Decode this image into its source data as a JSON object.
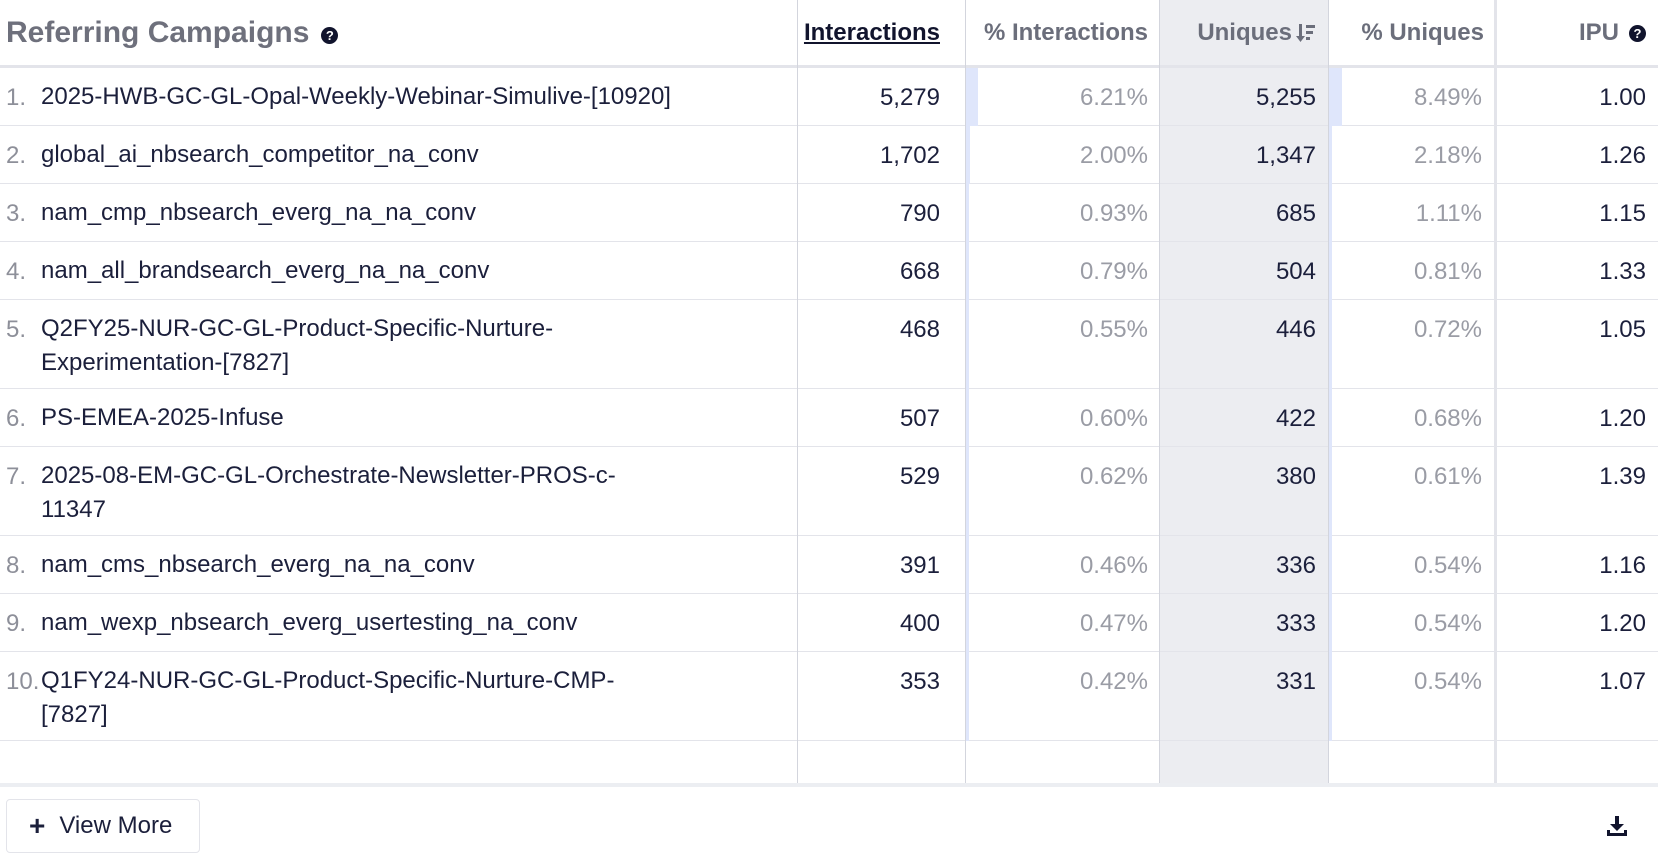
{
  "header": {
    "title": "Referring Campaigns",
    "help_icon": "question-circle-icon",
    "columns": [
      "Interactions",
      "% Interactions",
      "Uniques",
      "% Uniques",
      "IPU"
    ],
    "sort_icon": "sort-descending-icon"
  },
  "rows": [
    {
      "index": "1.",
      "name_lines": [
        "2025-HWB-GC-GL-Opal-Weekly-Webinar-Simulive-[10920]"
      ],
      "interactions": "5,279",
      "pct_interactions": "6.21%",
      "pct_interactions_value": 6.21,
      "uniques": "5,255",
      "pct_uniques": "8.49%",
      "pct_uniques_value": 8.49,
      "ipu": "1.00"
    },
    {
      "index": "2.",
      "name_lines": [
        "global_ai_nbsearch_competitor_na_conv"
      ],
      "interactions": "1,702",
      "pct_interactions": "2.00%",
      "pct_interactions_value": 2.0,
      "uniques": "1,347",
      "pct_uniques": "2.18%",
      "pct_uniques_value": 2.18,
      "ipu": "1.26"
    },
    {
      "index": "3.",
      "name_lines": [
        "nam_cmp_nbsearch_everg_na_na_conv"
      ],
      "interactions": "790",
      "pct_interactions": "0.93%",
      "pct_interactions_value": 0.93,
      "uniques": "685",
      "pct_uniques": "1.11%",
      "pct_uniques_value": 1.11,
      "ipu": "1.15"
    },
    {
      "index": "4.",
      "name_lines": [
        "nam_all_brandsearch_everg_na_na_conv"
      ],
      "interactions": "668",
      "pct_interactions": "0.79%",
      "pct_interactions_value": 0.79,
      "uniques": "504",
      "pct_uniques": "0.81%",
      "pct_uniques_value": 0.81,
      "ipu": "1.33"
    },
    {
      "index": "5.",
      "name_lines": [
        "Q2FY25-NUR-GC-GL-Product-Specific-Nurture-",
        "Experimentation-[7827]"
      ],
      "interactions": "468",
      "pct_interactions": "0.55%",
      "pct_interactions_value": 0.55,
      "uniques": "446",
      "pct_uniques": "0.72%",
      "pct_uniques_value": 0.72,
      "ipu": "1.05"
    },
    {
      "index": "6.",
      "name_lines": [
        "PS-EMEA-2025-Infuse"
      ],
      "interactions": "507",
      "pct_interactions": "0.60%",
      "pct_interactions_value": 0.6,
      "uniques": "422",
      "pct_uniques": "0.68%",
      "pct_uniques_value": 0.68,
      "ipu": "1.20"
    },
    {
      "index": "7.",
      "name_lines": [
        "2025-08-EM-GC-GL-Orchestrate-Newsletter-PROS-c-",
        "11347"
      ],
      "interactions": "529",
      "pct_interactions": "0.62%",
      "pct_interactions_value": 0.62,
      "uniques": "380",
      "pct_uniques": "0.61%",
      "pct_uniques_value": 0.61,
      "ipu": "1.39"
    },
    {
      "index": "8.",
      "name_lines": [
        "nam_cms_nbsearch_everg_na_na_conv"
      ],
      "interactions": "391",
      "pct_interactions": "0.46%",
      "pct_interactions_value": 0.46,
      "uniques": "336",
      "pct_uniques": "0.54%",
      "pct_uniques_value": 0.54,
      "ipu": "1.16"
    },
    {
      "index": "9.",
      "name_lines": [
        "nam_wexp_nbsearch_everg_usertesting_na_conv"
      ],
      "interactions": "400",
      "pct_interactions": "0.47%",
      "pct_interactions_value": 0.47,
      "uniques": "333",
      "pct_uniques": "0.54%",
      "pct_uniques_value": 0.54,
      "ipu": "1.20"
    },
    {
      "index": "10.",
      "name_lines": [
        "Q1FY24-NUR-GC-GL-Product-Specific-Nurture-CMP-",
        "[7827]"
      ],
      "interactions": "353",
      "pct_interactions": "0.42%",
      "pct_interactions_value": 0.42,
      "uniques": "331",
      "pct_uniques": "0.54%",
      "pct_uniques_value": 0.54,
      "ipu": "1.07"
    }
  ],
  "footer": {
    "view_more_label": "View More",
    "plus_icon": "plus-icon",
    "download_icon": "download-icon"
  },
  "colors": {
    "bar": "#dfe6fb",
    "sorted_column_bg": "#ecedf1",
    "text": "#1b1f3b",
    "muted": "#9a9ca5"
  }
}
